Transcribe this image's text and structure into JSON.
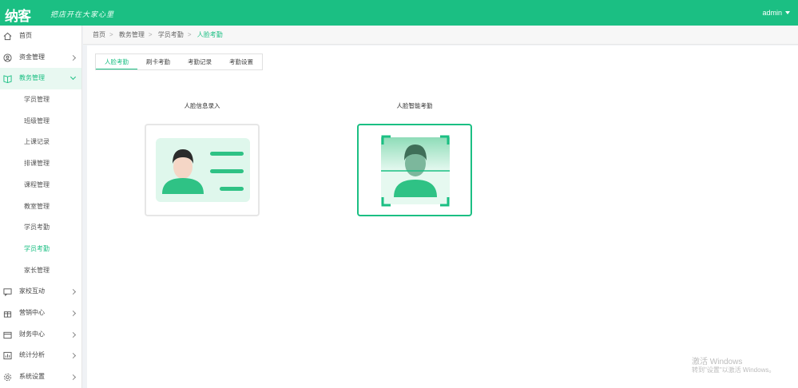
{
  "header": {
    "logo": "纳客",
    "slogan": "把店开在大家心里",
    "user": "admin",
    "brand_color": "#1bbf83"
  },
  "sidebar": {
    "items": [
      {
        "label": "首页",
        "icon": "home-icon"
      },
      {
        "label": "资金管理",
        "icon": "user-circle-icon"
      },
      {
        "label": "教务管理",
        "icon": "book-icon",
        "open": true,
        "children": [
          "学员管理",
          "班级管理",
          "上课记录",
          "排课管理",
          "课程管理",
          "教室管理",
          "学员考勤",
          "学员考勤",
          "家长管理"
        ]
      },
      {
        "label": "家校互动",
        "icon": "chat-icon"
      },
      {
        "label": "营销中心",
        "icon": "gift-icon"
      },
      {
        "label": "财务中心",
        "icon": "wallet-icon"
      },
      {
        "label": "统计分析",
        "icon": "chart-icon"
      },
      {
        "label": "系统设置",
        "icon": "gear-icon"
      }
    ],
    "active_child_index": 7
  },
  "breadcrumb": [
    "首页",
    "教务管理",
    "学员考勤",
    "人脸考勤"
  ],
  "tabs": [
    "人脸考勤",
    "刷卡考勤",
    "考勤记录",
    "考勤设置"
  ],
  "cards": {
    "left_title": "人脸信息录入",
    "right_title": "人脸智能考勤"
  },
  "watermark": {
    "line1": "激活 Windows",
    "line2": "转到\"设置\"以激活 Windows。"
  }
}
